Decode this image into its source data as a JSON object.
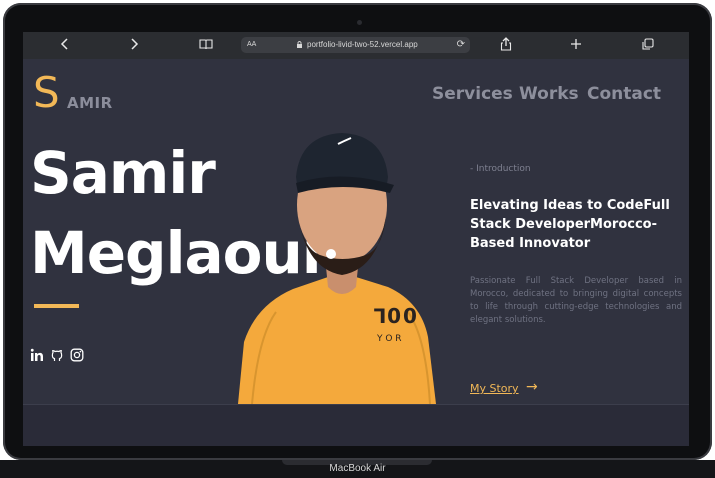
{
  "browser": {
    "url": "portfolio-livid-two-52.vercel.app",
    "text_size_label": "AA",
    "back_icon": "chevron-left-icon",
    "forward_icon": "chevron-right-icon",
    "reader_icon": "book-icon",
    "reload_icon": "reload-icon",
    "share_icon": "share-icon",
    "new_tab_icon": "plus-icon",
    "tabs_icon": "tabs-icon"
  },
  "site": {
    "logo_initial": "S",
    "logo_rest": "AMIR",
    "nav": [
      "Services",
      "Works",
      "Contact"
    ],
    "hero_line1": "Samir",
    "hero_line2": "Meglaoui",
    "intro_label": "- Introduction",
    "headline": "Elevating Ideas to CodeFull Stack DeveloperMorocco-Based Innovator",
    "description": "Passionate Full Stack Developer based in Morocco, dedicated to bringing digital concepts to life through cutting-edge technologies and elegant solutions.",
    "cta_label": "My Story",
    "cta_arrow": "→",
    "shirt_text_1": "⅂00",
    "shirt_text_2": "Y O R",
    "social_icons": [
      "linkedin-icon",
      "github-icon",
      "instagram-icon"
    ]
  },
  "device": {
    "label": "MacBook Air"
  },
  "colors": {
    "accent": "#f2b857",
    "background": "#30323f",
    "nav_text": "#8d8f9c",
    "hero_text": "#ffffff",
    "browser_chrome": "#2b2d31"
  }
}
